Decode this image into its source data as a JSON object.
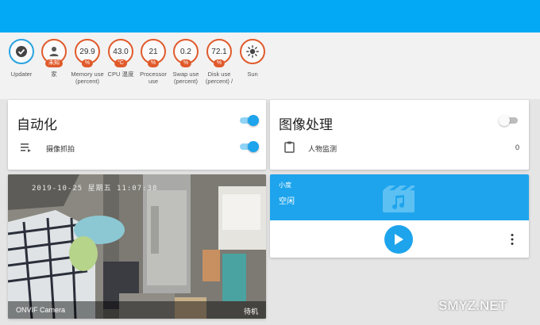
{
  "badges": [
    {
      "label": "Updater",
      "value": "",
      "unit": "",
      "icon": "check-circle-icon"
    },
    {
      "label": "家",
      "value": "",
      "unit": "未知",
      "icon": "person-icon"
    },
    {
      "label": "Memory use (percent)",
      "value": "29.9",
      "unit": "%"
    },
    {
      "label": "CPU 温度",
      "value": "43.0",
      "unit": "°C"
    },
    {
      "label": "Processor use",
      "value": "21",
      "unit": "%"
    },
    {
      "label": "Swap use (percent)",
      "value": "0.2",
      "unit": "%"
    },
    {
      "label": "Disk use (percent) /",
      "value": "72.1",
      "unit": "%"
    },
    {
      "label": "Sun",
      "value": "",
      "unit": "",
      "icon": "sun-icon"
    }
  ],
  "automation": {
    "title": "自动化",
    "toggle_on": true,
    "rows": [
      {
        "label": "摄像抓拍",
        "icon": "playlist-icon",
        "on": true
      }
    ]
  },
  "image": {
    "title": "图像处理",
    "toggle_on": false,
    "rows": [
      {
        "label": "人物监测",
        "icon": "clipboard-icon",
        "value": "0"
      }
    ]
  },
  "camera": {
    "timestamp": "2019-10-25 星期五 11:07:38",
    "name": "ONVIF Camera",
    "state": "待机"
  },
  "media": {
    "name": "小度",
    "state": "空闲",
    "accent": "#1ea4ec"
  },
  "watermark": "SMYZ.NET"
}
